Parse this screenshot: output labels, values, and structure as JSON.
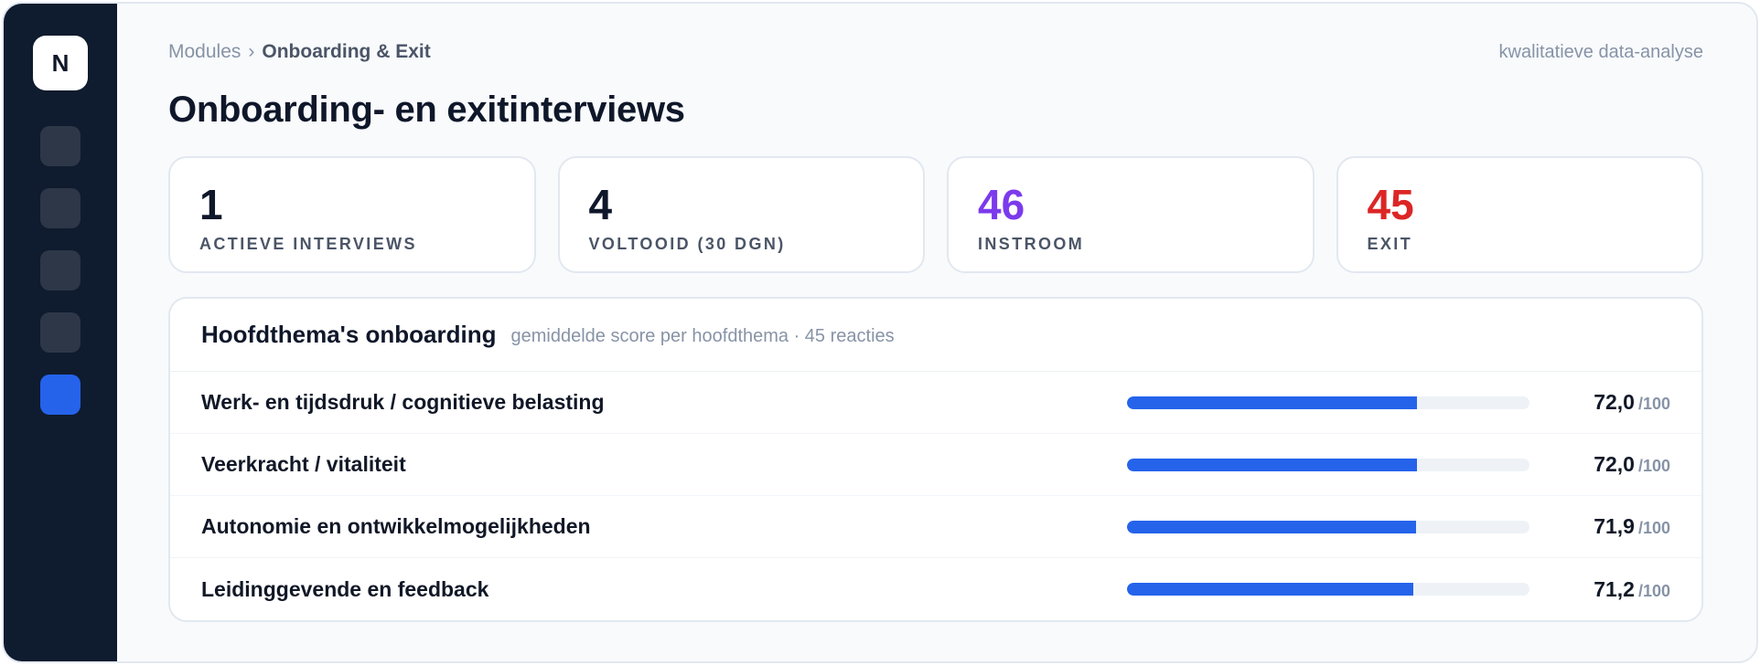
{
  "app": {
    "logo_letter": "N"
  },
  "sidebar": {
    "items": [
      {
        "name": "nav-1",
        "active": false
      },
      {
        "name": "nav-2",
        "active": false
      },
      {
        "name": "nav-3",
        "active": false
      },
      {
        "name": "nav-4",
        "active": false
      },
      {
        "name": "nav-5",
        "active": true
      }
    ]
  },
  "breadcrumb": {
    "parent": "Modules",
    "separator": "›",
    "current": "Onboarding & Exit"
  },
  "header": {
    "right_text": "kwalitatieve data-analyse",
    "title": "Onboarding- en exitinterviews"
  },
  "stats": [
    {
      "value": "1",
      "label": "ACTIEVE INTERVIEWS",
      "color": "#0f172a"
    },
    {
      "value": "4",
      "label": "VOLTOOID (30 DGN)",
      "color": "#0f172a"
    },
    {
      "value": "46",
      "label": "INSTROOM",
      "color": "#7c3aed"
    },
    {
      "value": "45",
      "label": "EXIT",
      "color": "#dc2626"
    }
  ],
  "panel": {
    "title": "Hoofdthema's onboarding",
    "subtitle": "gemiddelde score per hoofdthema · 45 reacties",
    "accent": "#2563eb",
    "rows": [
      {
        "label": "Werk- en tijdsdruk / cognitieve belasting",
        "score_text": "72,0",
        "max_text": "/100",
        "score": 72.0,
        "max": 100
      },
      {
        "label": "Veerkracht / vitaliteit",
        "score_text": "72,0",
        "max_text": "/100",
        "score": 72.0,
        "max": 100
      },
      {
        "label": "Autonomie en ontwikkelmogelijkheden",
        "score_text": "71,9",
        "max_text": "/100",
        "score": 71.9,
        "max": 100
      },
      {
        "label": "Leidinggevende en feedback",
        "score_text": "71,2",
        "max_text": "/100",
        "score": 71.2,
        "max": 100
      }
    ]
  }
}
